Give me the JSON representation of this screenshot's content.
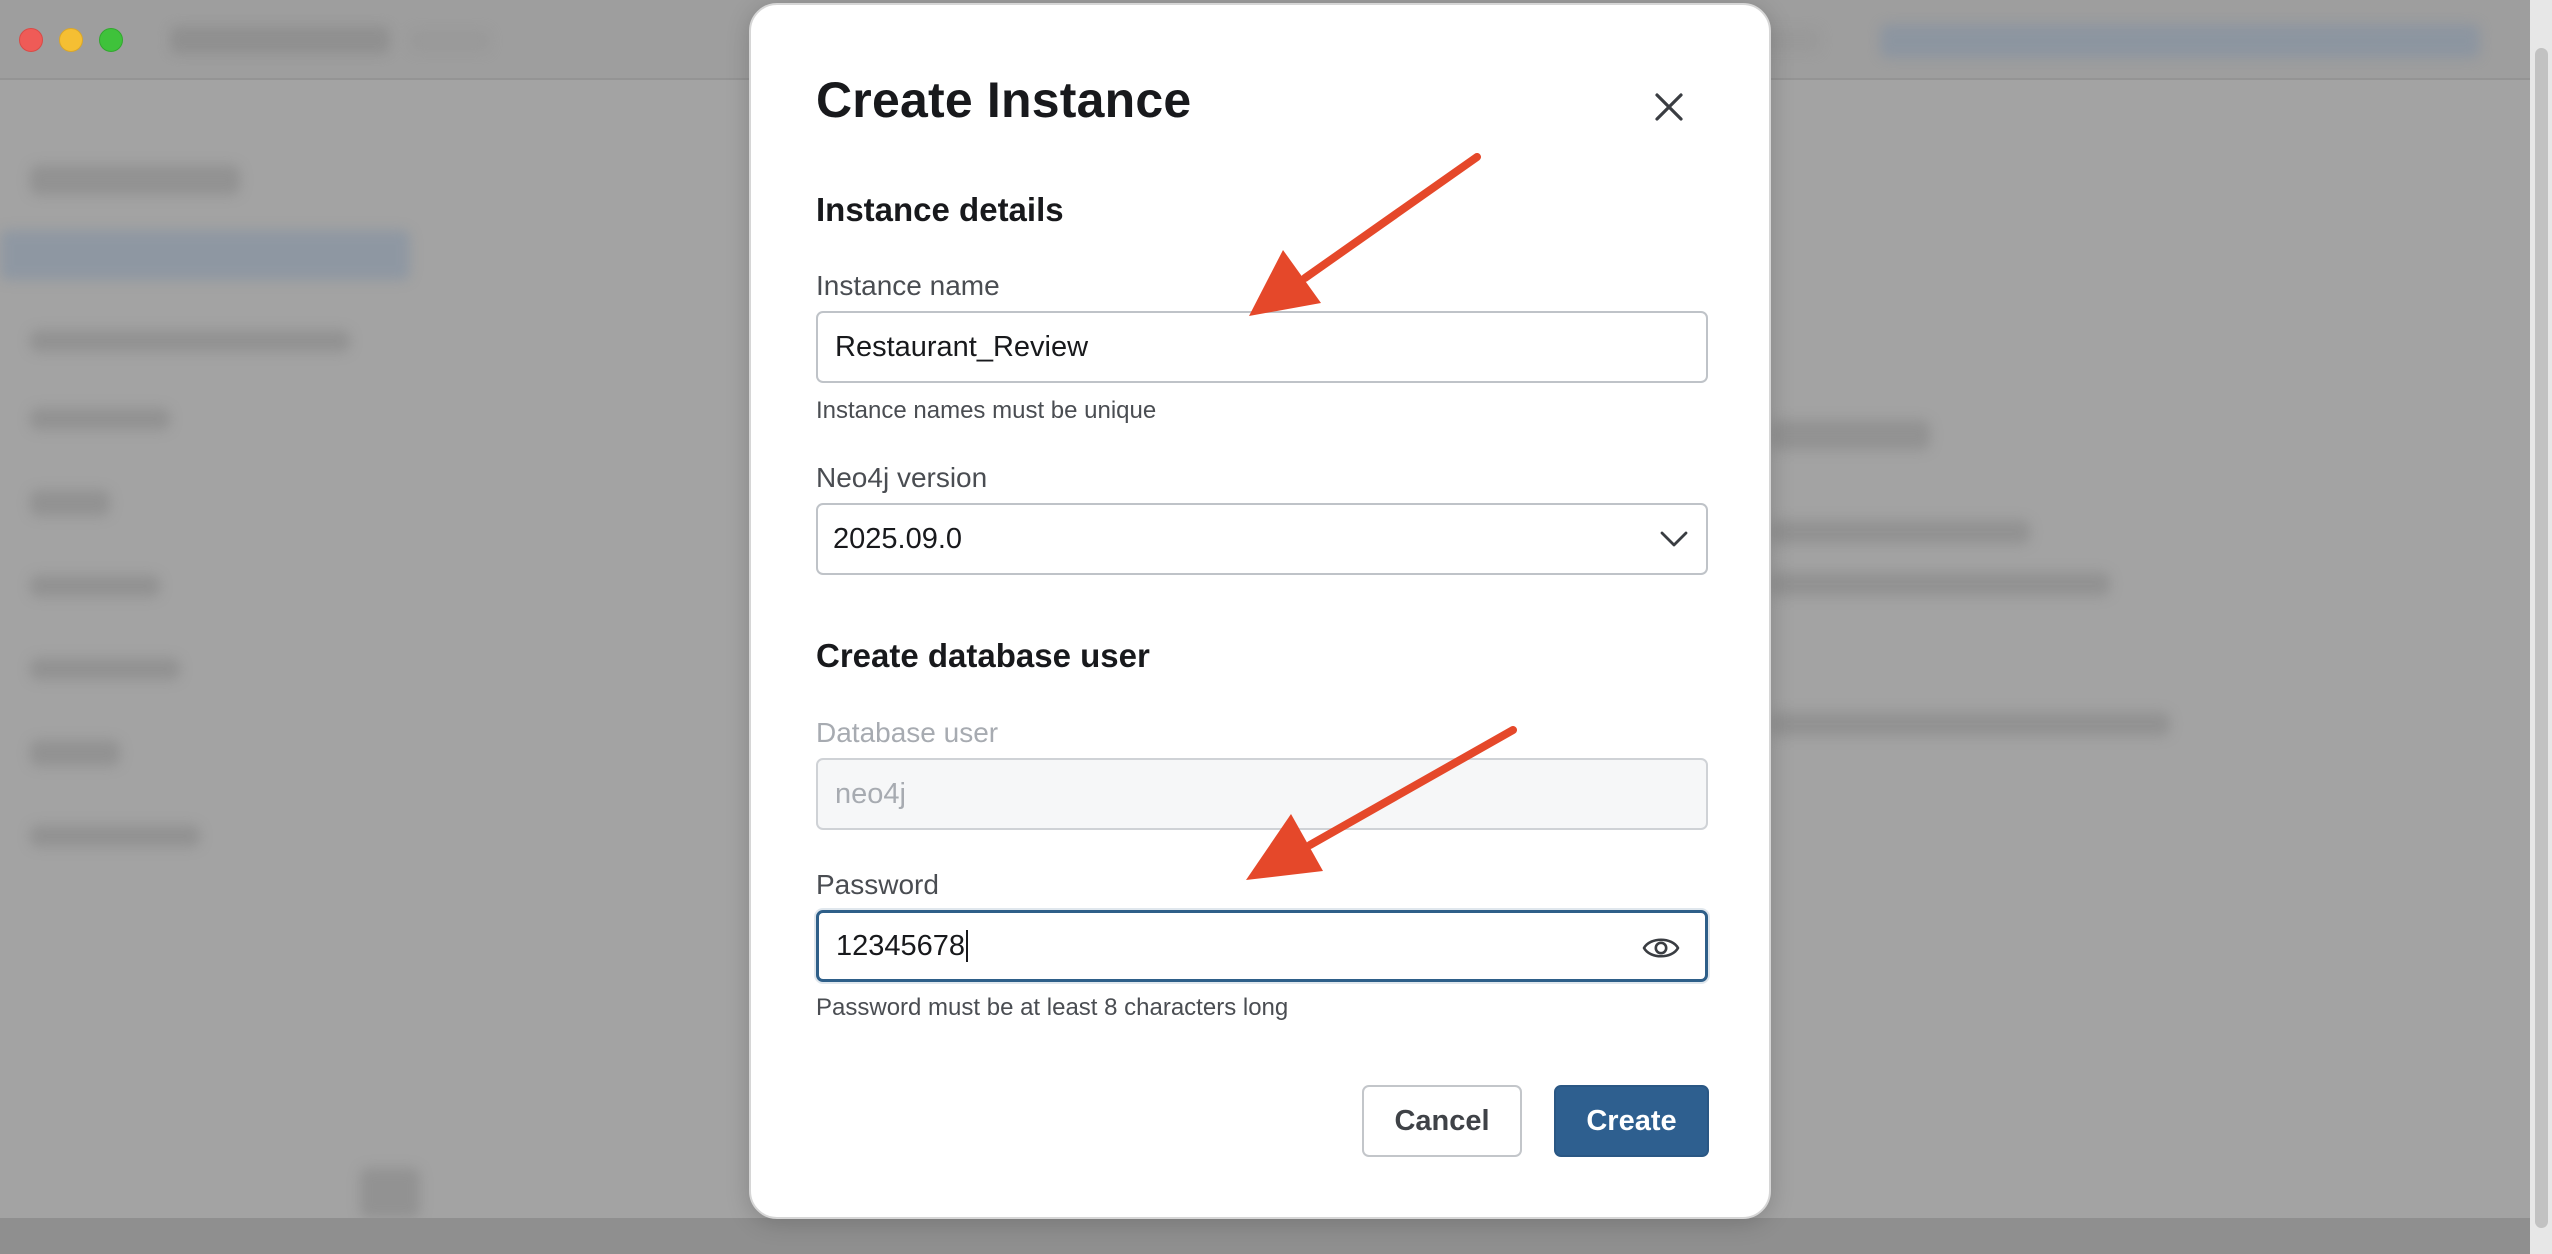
{
  "modal": {
    "title": "Create Instance",
    "close_icon": "close-icon",
    "instance_section_title": "Instance details",
    "instance_name": {
      "label": "Instance name",
      "value": "Restaurant_Review",
      "help": "Instance names must be unique"
    },
    "neo4j_version": {
      "label": "Neo4j version",
      "selected": "2025.09.0",
      "icon": "chevron-down-icon"
    },
    "user_section_title": "Create database user",
    "database_user": {
      "label": "Database user",
      "placeholder": "neo4j"
    },
    "password": {
      "label": "Password",
      "value": "12345678",
      "help": "Password must be at least 8 characters long",
      "icon": "eye-icon"
    },
    "buttons": {
      "cancel": "Cancel",
      "create": "Create"
    }
  },
  "colors": {
    "primary": "#2e5f8f",
    "focus_border": "#2e5f89",
    "annotation_arrow": "#e5482a",
    "traffic_red": "#ef5b57",
    "traffic_yellow": "#f5bf33",
    "traffic_green": "#3fc23b"
  }
}
